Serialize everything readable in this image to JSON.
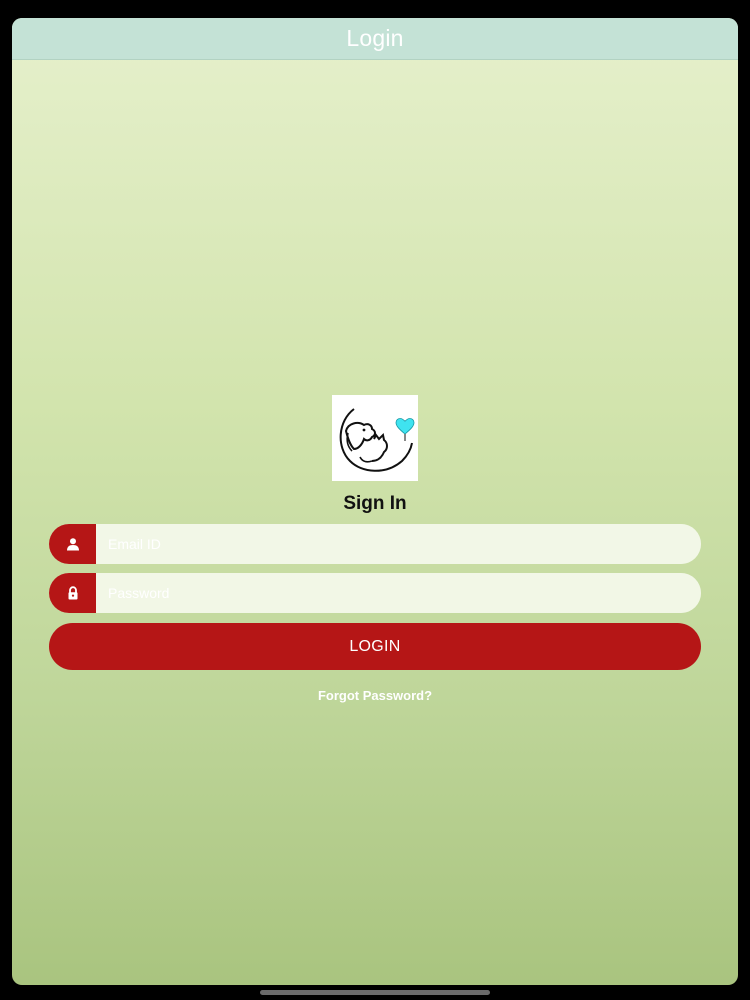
{
  "navbar": {
    "title": "Login"
  },
  "form": {
    "title": "Sign In",
    "email": {
      "placeholder": "Email ID",
      "value": ""
    },
    "password": {
      "placeholder": "Password",
      "value": ""
    },
    "login_label": "LOGIN",
    "forgot_label": "Forgot Password?"
  },
  "icons": {
    "logo": "pet-logo-icon",
    "email": "user-icon",
    "password": "lock-icon"
  },
  "colors": {
    "accent": "#b51616",
    "navbar": "#c4e2d6",
    "heart": "#3fe3f0"
  }
}
